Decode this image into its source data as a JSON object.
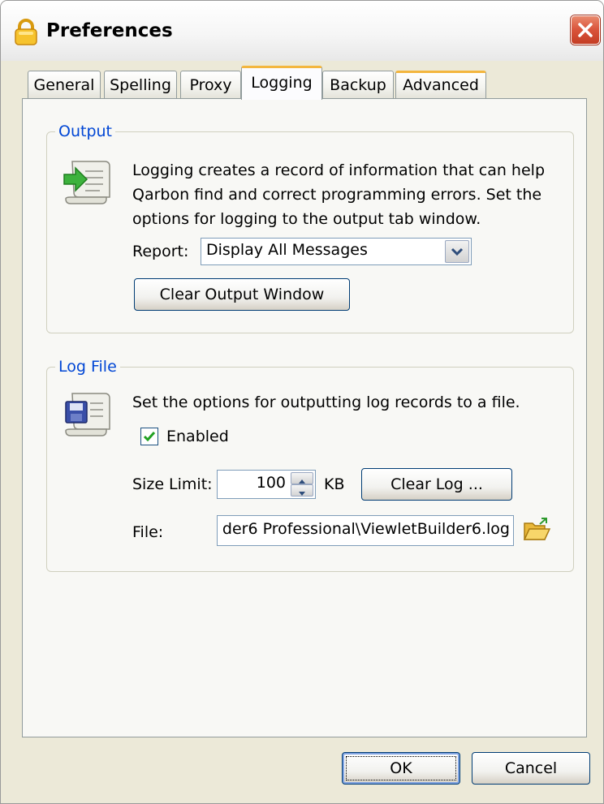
{
  "window": {
    "title": "Preferences"
  },
  "tabs": [
    {
      "label": "General"
    },
    {
      "label": "Spelling"
    },
    {
      "label": "Proxy"
    },
    {
      "label": "Logging"
    },
    {
      "label": "Backup"
    },
    {
      "label": "Advanced"
    }
  ],
  "active_tab": "Logging",
  "output": {
    "legend": "Output",
    "description_lines": [
      "Logging creates a record of information that can help",
      "Qarbon find and correct programming errors. Set the",
      "options for logging to the output tab window."
    ],
    "report_label": "Report:",
    "report_value": "Display All Messages",
    "clear_button": "Clear Output Window"
  },
  "log_file": {
    "legend": "Log File",
    "description": "Set the options for outputting log records to a file.",
    "enabled_label": "Enabled",
    "enabled_checked": true,
    "size_limit_label": "Size Limit:",
    "size_limit_value": "100",
    "size_unit": "KB",
    "clear_log_button": "Clear Log ...",
    "file_label": "File:",
    "file_value": "der6 Professional\\ViewletBuilder6.log"
  },
  "footer": {
    "ok": "OK",
    "cancel": "Cancel"
  },
  "icons": {
    "app": "lock-icon",
    "close": "close-icon",
    "output": "scroll-arrow-icon",
    "log_file": "scroll-disk-icon",
    "combo": "chevron-down-icon",
    "spin": "spin-arrows-icon",
    "browse": "folder-open-icon"
  },
  "colors": {
    "legend": "#0046d5",
    "tab_accent": "#f3b63e",
    "close": "#d9533a",
    "checkmark": "#21a121"
  }
}
